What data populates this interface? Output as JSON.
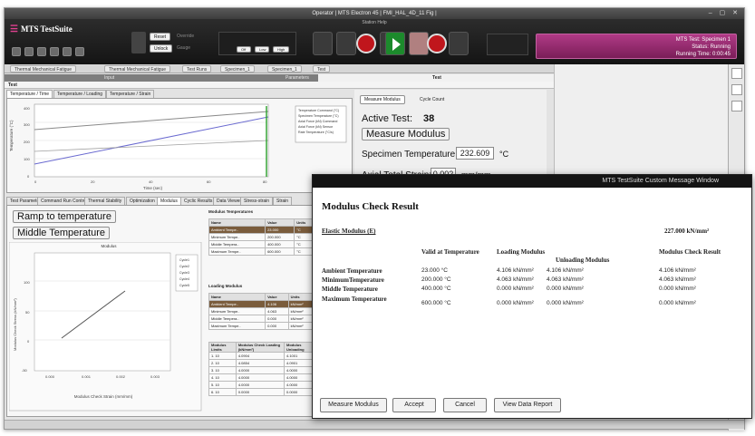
{
  "window": {
    "title": "Operator | MTS Electron 45 | FMI_HAL_4D_11 Fig |",
    "menubar_text": "Station   Help"
  },
  "toolbar": {
    "brand": "MTS TestSuite",
    "mode_buttons": [
      "Reset",
      "Override",
      "Unlock",
      "Gauge"
    ],
    "status": {
      "line1": "MTS Test: Specimen 1",
      "line2": "Status: Running",
      "line3": "Running Time: 0:00:45"
    }
  },
  "tabs": {
    "crumbs": [
      "Thermal Mechanical Fatigue",
      "Thermal Mechanical Fatigue",
      "Test Runs",
      "Specimen_1",
      "Specimen_1",
      "Test"
    ],
    "section_left": "Input",
    "section_mid": "Parameters",
    "section_right": "Test",
    "test_header": "Test"
  },
  "upper_panel": {
    "tabs": [
      "Temperature / Time",
      "Temperature / Loading",
      "Temperature / Strain"
    ],
    "ylabel": "Temperature (°C)",
    "xlabel": "Time (sec)",
    "y_ticks": [
      "400",
      "300",
      "200",
      "100",
      "0"
    ],
    "x_ticks": [
      "0",
      "20",
      "40",
      "60",
      "80"
    ],
    "legend": [
      "Temperature Command (°C)",
      "Specimen Temperature (°C)",
      "Axial Force (kN) Command",
      "Axial Force (kN) Sensor",
      "Rate Temperature (°C/s)"
    ]
  },
  "right_info": {
    "tabs": [
      "Measure Modulus",
      "Cycle Count"
    ],
    "active_test_label": "Active Test:",
    "active_test_value": "38",
    "measure_modulus": "Measure Modulus",
    "spec_temp_label": "Specimen Temperature:",
    "spec_temp_value": "232.609",
    "spec_temp_unit": "°C",
    "strain_label": "Axial Total Strain:",
    "strain_value": "0.002",
    "strain_unit": "mm/mm"
  },
  "lower_panel": {
    "tabs": [
      "Test Parameters",
      "Command Run Controls",
      "Thermal Stability",
      "Optimization",
      "Modulus",
      "Cyclic Results",
      "Data Viewer",
      "Stress-strain",
      "Strain"
    ],
    "btn_ramp": "Ramp to temperature",
    "btn_middle": "Middle Temperature",
    "chart_title": "Modulus",
    "ylabel": "Modulus Check Stress (kN/mm²)",
    "xlabel": "Modulus Check Strain (mm/mm)",
    "y_ticks": [
      "100",
      "50",
      "0",
      "-50"
    ],
    "x_ticks": [
      "0.000",
      "0.001",
      "0.002",
      "0.003"
    ],
    "legend": [
      "Cycle1",
      "Cycle2",
      "Cycle3",
      "Cycle4",
      "Cycle5"
    ],
    "tbl_temps_title": "Modulus Temperatures",
    "tbl_temps": [
      [
        "Name",
        "Value",
        "Units"
      ],
      [
        "Ambient Tempe..",
        "23.000",
        "°C"
      ],
      [
        "Minimum Tempe..",
        "200.000",
        "°C"
      ],
      [
        "Middle Tempera..",
        "400.000",
        "°C"
      ],
      [
        "Maximum Tempe..",
        "600.000",
        "°C"
      ]
    ],
    "tbl_loading_title": "Loading Modulus",
    "tbl_loading": [
      [
        "Name",
        "Value",
        "Units"
      ],
      [
        "Ambient Tempe..",
        "4.106",
        "kN/mm²"
      ],
      [
        "Minimum Tempe..",
        "4.063",
        "kN/mm²"
      ],
      [
        "Middle Tempera..",
        "0.000",
        "kN/mm²"
      ],
      [
        "Maximum Tempe..",
        "0.000",
        "kN/mm²"
      ]
    ],
    "tbl_result_head": [
      "Modulus Limits",
      "Modulus Check Loading (kN/mm²)",
      "Modulus Unloading"
    ],
    "tbl_result_rows": [
      [
        "1. 10",
        "4.0904",
        "4.1001"
      ],
      [
        "2. 10",
        "4.0854",
        "4.0901"
      ],
      [
        "3. 10",
        "4.0000",
        "4.0000"
      ],
      [
        "4. 10",
        "4.0000",
        "4.0000"
      ],
      [
        "5. 10",
        "4.0000",
        "4.0000"
      ],
      [
        "6. 10",
        "0.0000",
        "0.0000"
      ]
    ]
  },
  "dialog": {
    "title": "MTS TestSuite Custom Message Window",
    "heading": "Modulus Check Result",
    "elastic_label": "Elastic Modulus (E)",
    "elastic_value": "227.000 kN/mm²",
    "columns": [
      "Valid at Temperature",
      "Loading Modulus",
      "Unloading Modulus",
      "Modulus Check Result"
    ],
    "rows": [
      {
        "name": "Ambient Temperature",
        "temp": "23.000 °C",
        "loading": "4.106 kN/mm²",
        "unloading": "4.106 kN/mm²",
        "result": "4.106 kN/mm²"
      },
      {
        "name": "MinimumTemperature",
        "temp": "200.000 °C",
        "loading": "4.063 kN/mm²",
        "unloading": "4.063 kN/mm²",
        "result": "4.063 kN/mm²"
      },
      {
        "name": "Middle Temperature",
        "temp": "400.000 °C",
        "loading": "0.000 kN/mm²",
        "unloading": "0.000 kN/mm²",
        "result": "0.000 kN/mm²"
      },
      {
        "name": "Maximum Temperature",
        "temp": "600.000 °C",
        "loading": "0.000 kN/mm²",
        "unloading": "0.000 kN/mm²",
        "result": "0.000 kN/mm²"
      }
    ],
    "buttons": [
      "Measure Modulus",
      "Accept",
      "Cancel",
      "View Data Report"
    ]
  },
  "colors": {
    "accent": "#8a2a6a",
    "play_green": "#1c8a2c",
    "stop_red": "#c0161c",
    "dialog_titlebar": "#141414"
  }
}
